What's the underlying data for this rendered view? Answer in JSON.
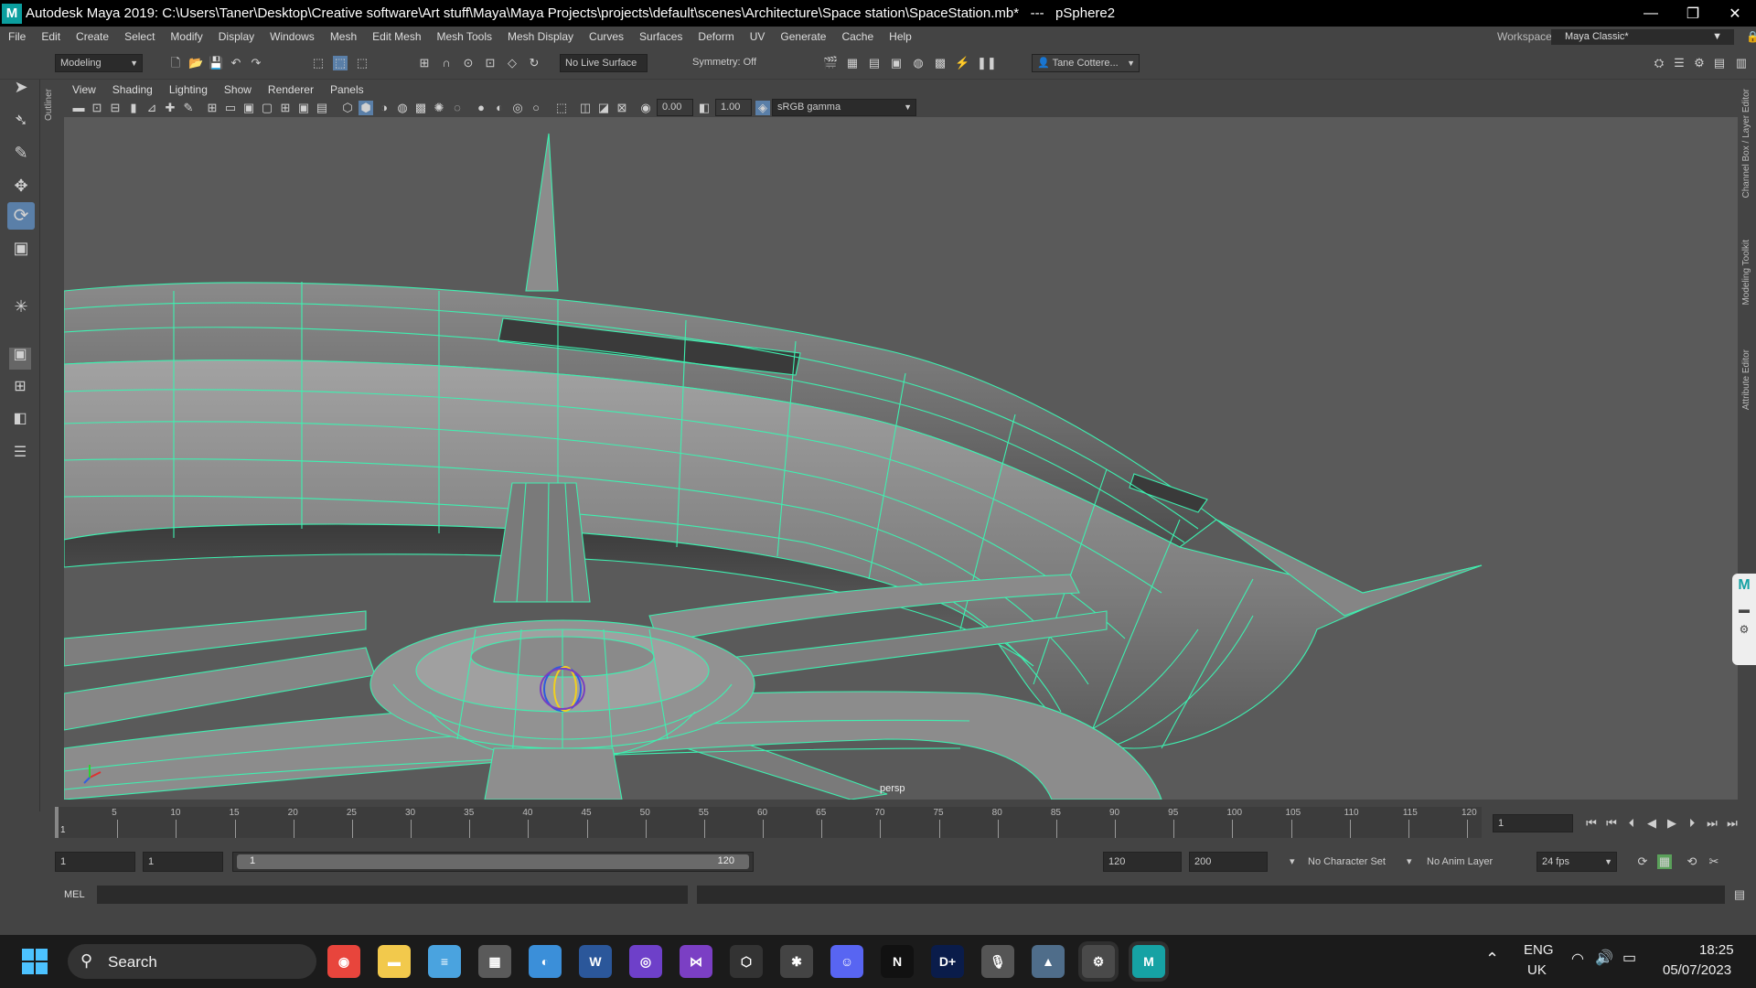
{
  "titlebar": {
    "title": "Autodesk Maya 2019: C:\\Users\\Taner\\Desktop\\Creative software\\Art stuff\\Maya\\Maya Projects\\projects\\default\\scenes\\Architecture\\Space station\\SpaceStation.mb*   ---   pSphere2",
    "logo": "M"
  },
  "menu": [
    "File",
    "Edit",
    "Create",
    "Select",
    "Modify",
    "Display",
    "Windows",
    "Mesh",
    "Edit Mesh",
    "Mesh Tools",
    "Mesh Display",
    "Curves",
    "Surfaces",
    "Deform",
    "UV",
    "Generate",
    "Cache",
    "Help"
  ],
  "workspace": {
    "label": "Workspace :",
    "value": "Maya Classic*"
  },
  "shelf": {
    "mode": "Modeling",
    "live_surface": "No Live Surface",
    "symmetry": "Symmetry: Off",
    "user": "Tane Cottere..."
  },
  "viewport_menu": [
    "View",
    "Shading",
    "Lighting",
    "Show",
    "Renderer",
    "Panels"
  ],
  "viewport_tools": {
    "exposure": "0.00",
    "gamma": "1.00",
    "colorspace": "sRGB gamma"
  },
  "viewport": {
    "camera_label": "persp",
    "wire_color": "#3ef0b0"
  },
  "side_labels": {
    "outliner": "Outliner",
    "channel_box": "Channel Box / Layer Editor",
    "modeling_toolkit": "Modeling Toolkit",
    "attribute_editor": "Attribute Editor"
  },
  "timeline": {
    "ticks": [
      "5",
      "10",
      "15",
      "20",
      "25",
      "30",
      "35",
      "40",
      "45",
      "50",
      "55",
      "60",
      "65",
      "70",
      "75",
      "80",
      "85",
      "90",
      "95",
      "100",
      "105",
      "110",
      "115",
      "120"
    ],
    "start_marker": "1",
    "current_frame": "1"
  },
  "range": {
    "start": "1",
    "anim_start": "1",
    "slider_start": "1",
    "slider_end": "120",
    "anim_end": "120",
    "end": "200",
    "character_set": "No Character Set",
    "anim_layer": "No Anim Layer",
    "fps": "24 fps"
  },
  "cmdline": {
    "label": "MEL"
  },
  "taskbar": {
    "search": "Search",
    "lang1": "ENG",
    "lang2": "UK",
    "time": "18:25",
    "date": "05/07/2023",
    "apps": [
      {
        "name": "chrome-icon",
        "color": "#e8453c",
        "glyph": "◉"
      },
      {
        "name": "file-explorer-icon",
        "color": "#f2c94c",
        "glyph": "▬"
      },
      {
        "name": "notepad-icon",
        "color": "#4aa3df",
        "glyph": "≡"
      },
      {
        "name": "calculator-icon",
        "color": "#5a5a5a",
        "glyph": "▦"
      },
      {
        "name": "paint-icon",
        "color": "#3b8fd9",
        "glyph": "◐"
      },
      {
        "name": "word-icon",
        "color": "#2b579a",
        "glyph": "W"
      },
      {
        "name": "github-icon",
        "color": "#6e40c9",
        "glyph": "◎"
      },
      {
        "name": "visual-studio-icon",
        "color": "#7b3fc4",
        "glyph": "⋈"
      },
      {
        "name": "unity-icon",
        "color": "#333333",
        "glyph": "⬡"
      },
      {
        "name": "slack-icon",
        "color": "#444444",
        "glyph": "✱"
      },
      {
        "name": "discord-icon",
        "color": "#5865f2",
        "glyph": "☺"
      },
      {
        "name": "netflix-icon",
        "color": "#111111",
        "glyph": "N"
      },
      {
        "name": "disney-plus-icon",
        "color": "#0a1c4a",
        "glyph": "D+"
      },
      {
        "name": "microphone-icon",
        "color": "#555555",
        "glyph": "🎙"
      },
      {
        "name": "stocks-icon",
        "color": "#4f6d8a",
        "glyph": "▲"
      },
      {
        "name": "settings-icon",
        "color": "#4a4a4a",
        "glyph": "⚙"
      },
      {
        "name": "maya-icon",
        "color": "#16a2a4",
        "glyph": "M"
      }
    ]
  }
}
